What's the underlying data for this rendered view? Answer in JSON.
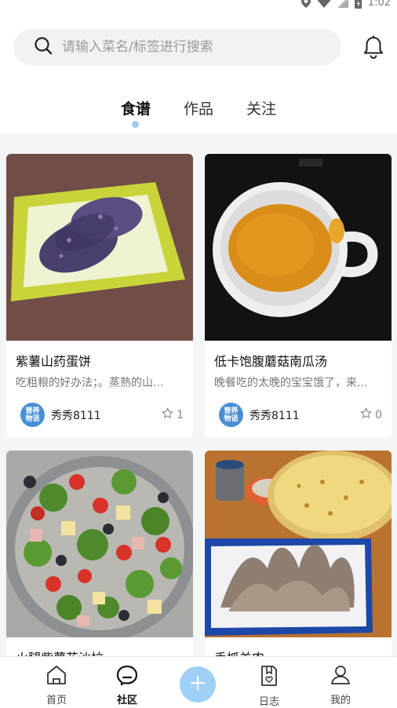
{
  "status_bar": {
    "time": "1:02"
  },
  "search": {
    "placeholder": "请输入菜名/标签进行搜索"
  },
  "tabs": [
    {
      "label": "食谱",
      "active": true
    },
    {
      "label": "作品",
      "active": false
    },
    {
      "label": "关注",
      "active": false
    }
  ],
  "cards": [
    {
      "title": "紫薯山药蛋饼",
      "desc": "吃粗粮的好办法；。蒸熟的山...",
      "author": "秀秀8111",
      "avatar_lines": [
        "营养",
        "物语"
      ],
      "stars": "1"
    },
    {
      "title": "低卡饱腹蘑菇南瓜汤",
      "desc": "晚餐吃的太晚的宝宝饿了，来...",
      "author": "秀秀8111",
      "avatar_lines": [
        "营养",
        "物语"
      ],
      "stars": "0"
    },
    {
      "title": "火腿紫薯花沙拉"
    },
    {
      "title": "手抓羊肉"
    }
  ],
  "bottom_nav": [
    {
      "label": "首页",
      "icon": "home-icon"
    },
    {
      "label": "社区",
      "icon": "community-icon",
      "active": true
    },
    {
      "label": "日志",
      "icon": "journal-icon"
    },
    {
      "label": "我的",
      "icon": "profile-icon"
    }
  ],
  "colors": {
    "accent": "#9dcdf2",
    "add_button": "#9fd0f5",
    "avatar": "#4a8fd4"
  }
}
